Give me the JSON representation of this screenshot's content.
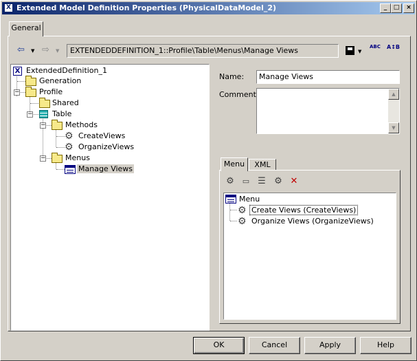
{
  "window": {
    "title": "Extended Model Definition Properties (PhysicalDataModel_2)",
    "app_icon": "model-icon",
    "minimize": "_",
    "maximize": "□",
    "close": "×"
  },
  "tabs": {
    "general": "General"
  },
  "toolbar": {
    "path": "EXTENDEDDEFINITION_1::Profile\\Table\\Menus\\Manage Views",
    "back_glyph": "⇦",
    "forward_glyph": "⇨",
    "dropdown_glyph": "▼",
    "spell_glyph": "ABC",
    "sort_glyph": "A↕B"
  },
  "tree": {
    "root": "ExtendedDefinition_1",
    "generation": "Generation",
    "profile": "Profile",
    "shared": "Shared",
    "table": "Table",
    "methods": "Methods",
    "create_views": "CreateViews",
    "organize_views": "OrganizeViews",
    "menus": "Menus",
    "manage_views": "Manage Views",
    "expander_minus": "−",
    "root_icon_glyph": "X"
  },
  "form": {
    "name_label": "Name:",
    "name_value": "Manage Views",
    "comment_label": "Comment:",
    "comment_value": ""
  },
  "inner_tabs": {
    "menu": "Menu",
    "xml": "XML"
  },
  "menu_toolbar": {
    "delete_glyph": "✕",
    "gear_glyph": "⚙"
  },
  "menu_tree": {
    "root": "Menu",
    "item1": "Create Views (CreateViews)",
    "item2": "Organize Views (OrganizeViews)"
  },
  "buttons": {
    "ok": "OK",
    "cancel": "Cancel",
    "apply": "Apply",
    "help": "Help"
  }
}
